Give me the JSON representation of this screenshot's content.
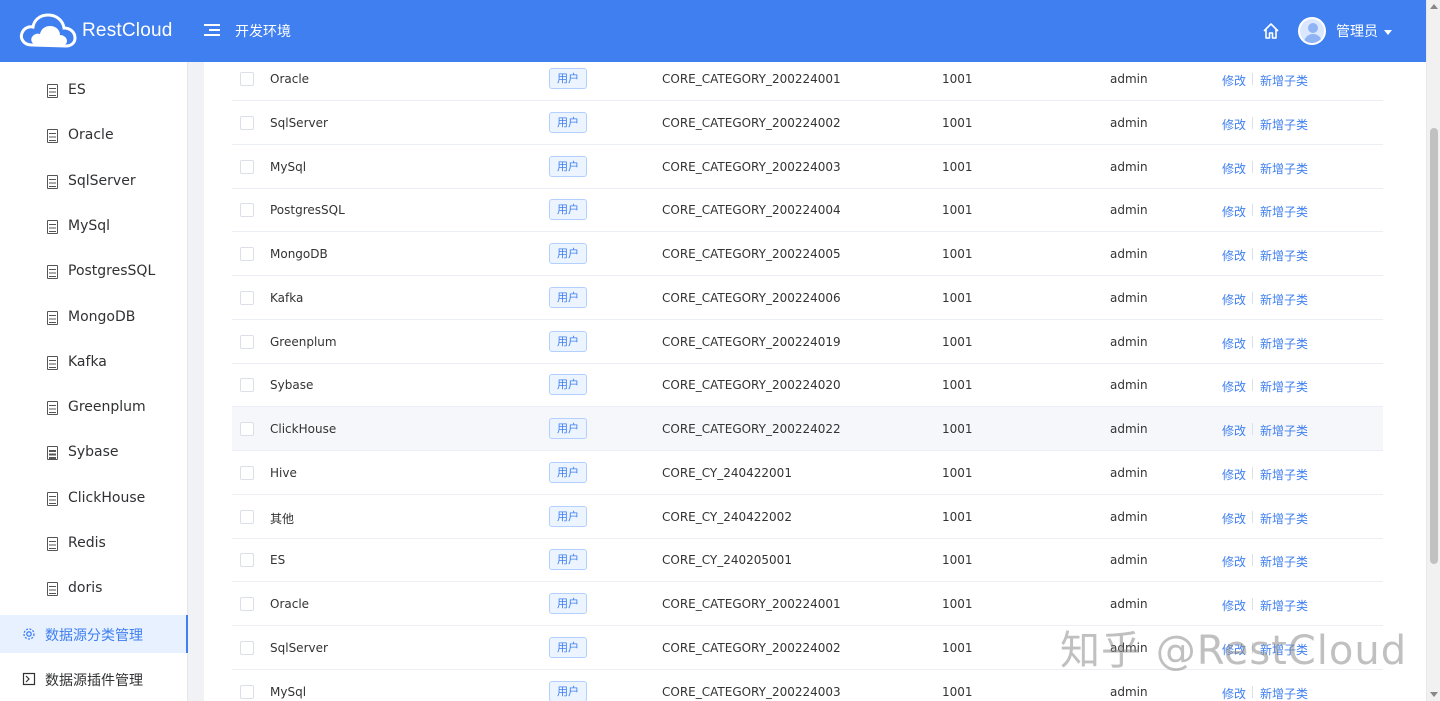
{
  "header": {
    "brand": "RestCloud",
    "env_title": "开发环境",
    "user": "管理员",
    "colors": {
      "primary": "#3f7ff0"
    }
  },
  "sidebar": {
    "items": [
      {
        "label": "ES"
      },
      {
        "label": "Oracle"
      },
      {
        "label": "SqlServer"
      },
      {
        "label": "MySql"
      },
      {
        "label": "PostgresSQL"
      },
      {
        "label": "MongoDB"
      },
      {
        "label": "Kafka"
      },
      {
        "label": "Greenplum"
      },
      {
        "label": "Sybase"
      },
      {
        "label": "ClickHouse"
      },
      {
        "label": "Redis"
      },
      {
        "label": "doris"
      }
    ],
    "groups": [
      {
        "label": "数据源分类管理",
        "icon": "gear-icon",
        "active": true
      },
      {
        "label": "数据源插件管理",
        "icon": "plugin-icon",
        "active": false
      }
    ]
  },
  "table": {
    "actions": {
      "edit": "修改",
      "add_child": "新增子类"
    },
    "rows": [
      {
        "name": "Oracle",
        "tag": "用户",
        "code": "CORE_CATEGORY_200224001",
        "num": "1001",
        "user": "admin"
      },
      {
        "name": "SqlServer",
        "tag": "用户",
        "code": "CORE_CATEGORY_200224002",
        "num": "1001",
        "user": "admin"
      },
      {
        "name": "MySql",
        "tag": "用户",
        "code": "CORE_CATEGORY_200224003",
        "num": "1001",
        "user": "admin"
      },
      {
        "name": "PostgresSQL",
        "tag": "用户",
        "code": "CORE_CATEGORY_200224004",
        "num": "1001",
        "user": "admin"
      },
      {
        "name": "MongoDB",
        "tag": "用户",
        "code": "CORE_CATEGORY_200224005",
        "num": "1001",
        "user": "admin"
      },
      {
        "name": "Kafka",
        "tag": "用户",
        "code": "CORE_CATEGORY_200224006",
        "num": "1001",
        "user": "admin"
      },
      {
        "name": "Greenplum",
        "tag": "用户",
        "code": "CORE_CATEGORY_200224019",
        "num": "1001",
        "user": "admin"
      },
      {
        "name": "Sybase",
        "tag": "用户",
        "code": "CORE_CATEGORY_200224020",
        "num": "1001",
        "user": "admin"
      },
      {
        "name": "ClickHouse",
        "tag": "用户",
        "code": "CORE_CATEGORY_200224022",
        "num": "1001",
        "user": "admin"
      },
      {
        "name": "Hive",
        "tag": "用户",
        "code": "CORE_CY_240422001",
        "num": "1001",
        "user": "admin"
      },
      {
        "name": "其他",
        "tag": "用户",
        "code": "CORE_CY_240422002",
        "num": "1001",
        "user": "admin"
      },
      {
        "name": "ES",
        "tag": "用户",
        "code": "CORE_CY_240205001",
        "num": "1001",
        "user": "admin"
      },
      {
        "name": "Oracle",
        "tag": "用户",
        "code": "CORE_CATEGORY_200224001",
        "num": "1001",
        "user": "admin"
      },
      {
        "name": "SqlServer",
        "tag": "用户",
        "code": "CORE_CATEGORY_200224002",
        "num": "1001",
        "user": "admin"
      },
      {
        "name": "MySql",
        "tag": "用户",
        "code": "CORE_CATEGORY_200224003",
        "num": "1001",
        "user": "admin"
      }
    ]
  },
  "watermark": "知乎 @RestCloud"
}
